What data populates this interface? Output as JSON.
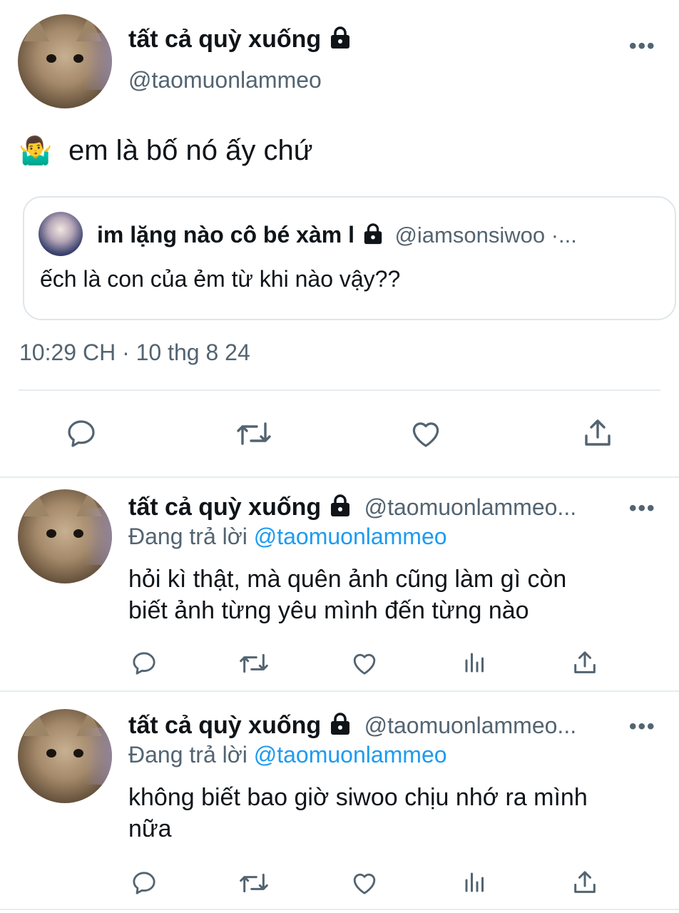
{
  "main_tweet": {
    "display_name": "tất cả quỳ xuống",
    "handle": "@taomuonlammeo",
    "more_label": "•••",
    "emoji": "🤷‍♂️",
    "text": "em là bố nó ấy chứ",
    "quoted": {
      "display_name": "im lặng nào cô bé xàm l",
      "handle": "@iamsonsiwoo ·...",
      "text": "ếch là con của ẻm từ khi nào vậy??"
    },
    "timestamp": "10:29 CH · 10 thg 8 24",
    "actions": [
      "reply-icon",
      "retweet-icon",
      "like-icon",
      "share-icon"
    ]
  },
  "replies": [
    {
      "display_name": "tất cả quỳ xuống",
      "handle": "@taomuonlammeo...",
      "more_label": "•••",
      "replying_prefix": "Đang trả lời",
      "replying_to": "@taomuonlammeo",
      "text_line1": "hỏi kì thật, mà quên ảnh cũng làm gì còn",
      "text_line2": "biết ảnh từng yêu mình đến từng nào"
    },
    {
      "display_name": "tất cả quỳ xuống",
      "handle": "@taomuonlammeo...",
      "more_label": "•••",
      "replying_prefix": "Đang trả lời",
      "replying_to": "@taomuonlammeo",
      "text_line1": "không biết bao giờ siwoo chịu nhớ ra mình",
      "text_line2": "nữa"
    }
  ],
  "colors": {
    "text": "#0f1419",
    "muted": "#536471",
    "link": "#1d9bf0",
    "divider": "#e6ecf0"
  }
}
